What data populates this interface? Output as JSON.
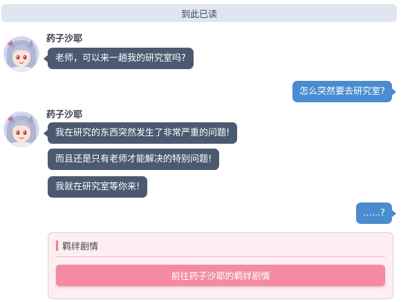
{
  "read_marker": "到此已读",
  "character": {
    "name": "药子沙耶"
  },
  "messages": [
    {
      "from": "character",
      "text": "老师，可以来一趟我的研究室吗?"
    },
    {
      "from": "user",
      "text": "怎么突然要去研究室?"
    },
    {
      "from": "character",
      "text": "我在研究的东西突然发生了非常严重的问题!"
    },
    {
      "from": "character",
      "text": "而且还是只有老师才能解决的特别问题!"
    },
    {
      "from": "character",
      "text": "我就在研究室等你来!"
    },
    {
      "from": "user",
      "text": "......?"
    }
  ],
  "bond_story": {
    "title": "羁绊剧情",
    "button_label": "前往药子沙耶的羁绊剧情"
  },
  "colors": {
    "incoming_bubble": "#4b5a70",
    "outgoing_bubble": "#4a8ccf",
    "bond_card_bg": "#fdeef1",
    "bond_button": "#f48ba0",
    "bond_accent": "#f27b93",
    "read_banner_bg": "#dfe6ef"
  }
}
